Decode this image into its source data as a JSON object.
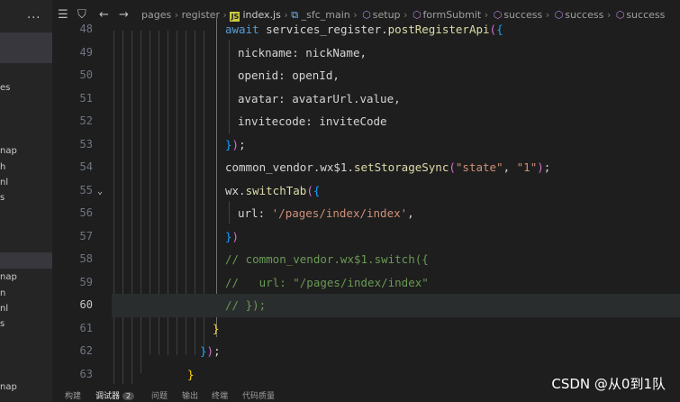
{
  "sidebar": {
    "more": "...",
    "fragments": [
      "es",
      "nap",
      "h",
      "nl",
      "s",
      "nap",
      "n",
      "nl",
      "s",
      "nap"
    ]
  },
  "breadcrumb": [
    "pages",
    "register",
    "index.js",
    "_sfc_main",
    "setup",
    "formSubmit",
    "success",
    "success",
    "success"
  ],
  "editor": {
    "lines": [
      {
        "n": "48"
      },
      {
        "n": "49"
      },
      {
        "n": "50"
      },
      {
        "n": "51"
      },
      {
        "n": "52"
      },
      {
        "n": "53"
      },
      {
        "n": "54"
      },
      {
        "n": "55"
      },
      {
        "n": "56"
      },
      {
        "n": "57"
      },
      {
        "n": "58"
      },
      {
        "n": "59"
      },
      {
        "n": "60"
      },
      {
        "n": "61"
      },
      {
        "n": "62"
      },
      {
        "n": "63"
      }
    ],
    "current_line": "60",
    "tokens": {
      "l48_await": "await",
      "l48_obj": "services_register.",
      "l48_fn": "postRegisterApi",
      "l48_paren": "(",
      "l48_brace": "{",
      "l49_key": "nickname",
      "l49_val": ": nickName,",
      "l50_key": "openid",
      "l50_val": ": openId,",
      "l51_key": "avatar",
      "l51_val": ": avatarUrl.value,",
      "l52_key": "invitecode",
      "l52_val": ": inviteCode",
      "l53_brace": "}",
      "l53_paren": ")",
      "l53_semi": ";",
      "l54_obj": "common_vendor.wx$1.",
      "l54_fn": "setStorageSync",
      "l54_paren_open": "(",
      "l54_arg1": "\"state\"",
      "l54_comma": ", ",
      "l54_arg2": "\"1\"",
      "l54_paren_close": ")",
      "l54_semi": ";",
      "l55_obj": "wx.",
      "l55_fn": "switchTab",
      "l55_paren": "(",
      "l55_brace": "{",
      "l56_key": "url",
      "l56_colon": ": ",
      "l56_val": "'/pages/index/index'",
      "l56_comma": ",",
      "l57_brace": "}",
      "l57_paren": ")",
      "l58_comment": "// common_vendor.wx$1.switch({",
      "l59_comment": "//   url: \"/pages/index/index\"",
      "l60_comment": "// });",
      "l61_brace": "}",
      "l62_brace": "}",
      "l62_paren": ")",
      "l62_semi": ";",
      "l63_brace": "}"
    }
  },
  "panel": {
    "tabs": [
      "构建",
      "调试器",
      "问题",
      "输出",
      "终端",
      "代码质量"
    ],
    "debugger_count": "2"
  },
  "watermark": "CSDN @从0到1队"
}
